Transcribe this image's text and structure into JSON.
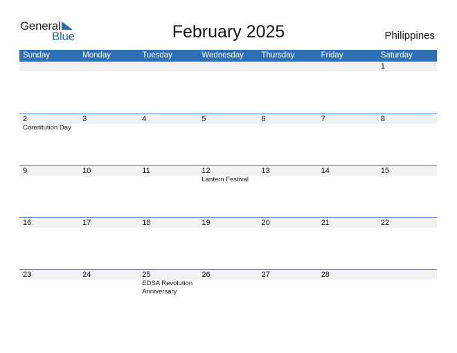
{
  "logo": {
    "word1": "General",
    "word2": "Blue",
    "accent": "#2a6db5"
  },
  "title": "February 2025",
  "country": "Philippines",
  "header_color": "#2e6fb5",
  "weekdays": [
    "Sunday",
    "Monday",
    "Tuesday",
    "Wednesday",
    "Thursday",
    "Friday",
    "Saturday"
  ],
  "weeks": [
    [
      {
        "day": ""
      },
      {
        "day": ""
      },
      {
        "day": ""
      },
      {
        "day": ""
      },
      {
        "day": ""
      },
      {
        "day": ""
      },
      {
        "day": "1"
      }
    ],
    [
      {
        "day": "2",
        "event": "Constitution Day"
      },
      {
        "day": "3"
      },
      {
        "day": "4"
      },
      {
        "day": "5"
      },
      {
        "day": "6"
      },
      {
        "day": "7"
      },
      {
        "day": "8"
      }
    ],
    [
      {
        "day": "9"
      },
      {
        "day": "10"
      },
      {
        "day": "11"
      },
      {
        "day": "12",
        "event": "Lantern Festival"
      },
      {
        "day": "13"
      },
      {
        "day": "14"
      },
      {
        "day": "15"
      }
    ],
    [
      {
        "day": "16"
      },
      {
        "day": "17"
      },
      {
        "day": "18"
      },
      {
        "day": "19"
      },
      {
        "day": "20"
      },
      {
        "day": "21"
      },
      {
        "day": "22"
      }
    ],
    [
      {
        "day": "23"
      },
      {
        "day": "24"
      },
      {
        "day": "25",
        "event": "EDSA Revolution Anniversary"
      },
      {
        "day": "26"
      },
      {
        "day": "27"
      },
      {
        "day": "28"
      },
      {
        "day": ""
      }
    ]
  ]
}
